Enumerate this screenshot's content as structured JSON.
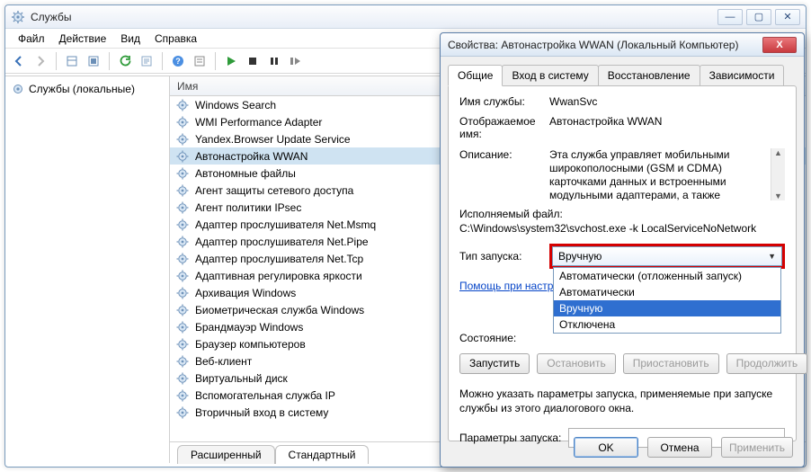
{
  "window": {
    "title": "Службы",
    "menu": [
      "Файл",
      "Действие",
      "Вид",
      "Справка"
    ],
    "tree_root": "Службы (локальные)",
    "list_header": "Имя",
    "bottom_tabs": {
      "extended": "Расширенный",
      "standard": "Стандартный"
    }
  },
  "services": [
    "Windows Search",
    "WMI Performance Adapter",
    "Yandex.Browser Update Service",
    "Автонастройка WWAN",
    "Автономные файлы",
    "Агент защиты сетевого доступа",
    "Агент политики IPsec",
    "Адаптер прослушивателя Net.Msmq",
    "Адаптер прослушивателя Net.Pipe",
    "Адаптер прослушивателя Net.Tcp",
    "Адаптивная регулировка яркости",
    "Архивация Windows",
    "Биометрическая служба Windows",
    "Брандмауэр Windows",
    "Браузер компьютеров",
    "Веб-клиент",
    "Виртуальный диск",
    "Вспомогательная служба IP",
    "Вторичный вход в систему"
  ],
  "selected_service_index": 3,
  "dialog": {
    "title": "Свойства: Автонастройка WWAN (Локальный Компьютер)",
    "tabs": [
      "Общие",
      "Вход в систему",
      "Восстановление",
      "Зависимости"
    ],
    "labels": {
      "service_name": "Имя службы:",
      "display_name": "Отображаемое имя:",
      "description": "Описание:",
      "exec_label": "Исполняемый файл:",
      "startup_type": "Тип запуска:",
      "help_link": "Помощь при настройке параметров запуска",
      "state": "Состояние:",
      "start": "Запустить",
      "stop": "Остановить",
      "pause": "Приостановить",
      "resume": "Продолжить",
      "note": "Можно указать параметры запуска, применяемые при запуске службы из этого диалогового окна.",
      "params": "Параметры запуска:",
      "ok": "OK",
      "cancel": "Отмена",
      "apply": "Применить"
    },
    "values": {
      "service_name": "WwanSvc",
      "display_name": "Автонастройка WWAN",
      "description": "Эта служба управляет мобильными широкополосными (GSM и CDMA) карточками данных и встроенными модульными адаптерами, а также подключениями и",
      "exec_path": "C:\\Windows\\system32\\svchost.exe -k LocalServiceNoNetwork",
      "startup_selected": "Вручную",
      "state": ""
    },
    "startup_options": [
      "Автоматически (отложенный запуск)",
      "Автоматически",
      "Вручную",
      "Отключена"
    ],
    "startup_highlight_index": 2
  }
}
